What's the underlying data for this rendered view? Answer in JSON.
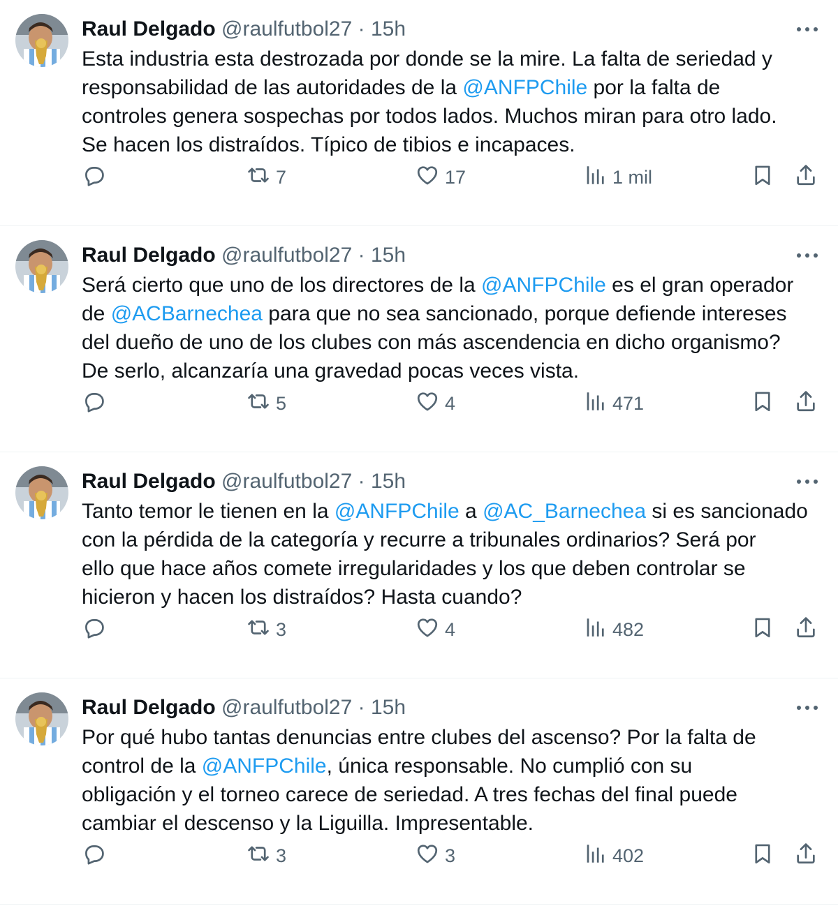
{
  "tweets": [
    {
      "name": "Raul Delgado",
      "handle": "@raulfutbol27",
      "dot": "·",
      "time": "15h",
      "lines": [
        [
          {
            "t": "Esta industria esta destrozada por donde se la mire. La falta de seriedad y"
          }
        ],
        [
          {
            "t": "responsabilidad de las autoridades de la "
          },
          {
            "t": "@ANFPChile",
            "m": true
          },
          {
            "t": " por la falta de"
          }
        ],
        [
          {
            "t": "controles genera sospechas por todos lados. Muchos miran para otro lado."
          }
        ],
        [
          {
            "t": "Se hacen los distraídos. Típico de tibios e incapaces."
          }
        ]
      ],
      "replies": "",
      "retweets": "7",
      "likes": "17",
      "views": "1 mil"
    },
    {
      "name": "Raul Delgado",
      "handle": "@raulfutbol27",
      "dot": "·",
      "time": "15h",
      "lines": [
        [
          {
            "t": "Será cierto que uno de los directores de la "
          },
          {
            "t": "@ANFPChile",
            "m": true
          },
          {
            "t": " es el gran operador"
          }
        ],
        [
          {
            "t": "de "
          },
          {
            "t": "@ACBarnechea",
            "m": true
          },
          {
            "t": " para que no sea sancionado, porque defiende intereses"
          }
        ],
        [
          {
            "t": "del dueño de uno de los clubes con más ascendencia en dicho organismo?"
          }
        ],
        [
          {
            "t": "De serlo, alcanzaría una gravedad pocas veces vista."
          }
        ]
      ],
      "replies": "",
      "retweets": "5",
      "likes": "4",
      "views": "471"
    },
    {
      "name": "Raul Delgado",
      "handle": "@raulfutbol27",
      "dot": "·",
      "time": "15h",
      "lines": [
        [
          {
            "t": "Tanto temor le tienen en la "
          },
          {
            "t": "@ANFPChile",
            "m": true
          },
          {
            "t": " a "
          },
          {
            "t": "@AC_Barnechea",
            "m": true
          },
          {
            "t": " si es sancionado"
          }
        ],
        [
          {
            "t": "con la pérdida de la categoría y  recurre a tribunales ordinarios? Será por"
          }
        ],
        [
          {
            "t": "ello que hace años comete irregularidades y los que deben controlar se"
          }
        ],
        [
          {
            "t": "hicieron y hacen los distraídos? Hasta cuando?"
          }
        ]
      ],
      "replies": "",
      "retweets": "3",
      "likes": "4",
      "views": "482"
    },
    {
      "name": "Raul Delgado",
      "handle": "@raulfutbol27",
      "dot": "·",
      "time": "15h",
      "lines": [
        [
          {
            "t": "Por qué hubo tantas denuncias entre clubes del ascenso? Por la falta de"
          }
        ],
        [
          {
            "t": "control de la "
          },
          {
            "t": "@ANFPChile",
            "m": true
          },
          {
            "t": ", única responsable. No cumplió con su"
          }
        ],
        [
          {
            "t": "obligación y el torneo carece de seriedad. A tres fechas del final puede"
          }
        ],
        [
          {
            "t": "cambiar el descenso y la Liguilla. Impresentable."
          }
        ]
      ],
      "replies": "",
      "retweets": "3",
      "likes": "3",
      "views": "402"
    }
  ],
  "colors": {
    "text": "#0f1419",
    "secondary": "#536471",
    "link": "#1d9bf0",
    "divider": "#eff3f4"
  },
  "icons": [
    "reply-icon",
    "retweet-icon",
    "like-icon",
    "views-icon",
    "bookmark-icon",
    "share-icon",
    "more-icon",
    "avatar"
  ]
}
